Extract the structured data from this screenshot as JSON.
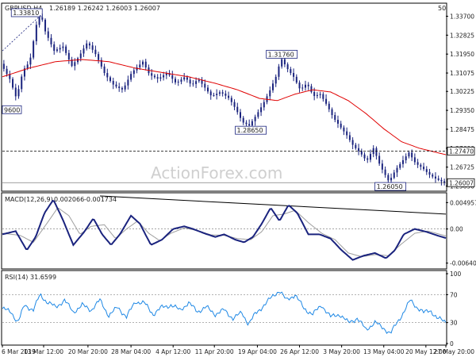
{
  "chart_data": [
    {
      "type": "candlestick",
      "header": {
        "symbol_tf": "GBPUSD,H4",
        "ohlc": "1.26189 1.26242 1.26003 1.26007",
        "corner_value": "50"
      },
      "y_ticks": [
        "1.33700",
        "1.32825",
        "1.31950",
        "1.31075",
        "1.30225",
        "1.29350",
        "1.28475",
        "1.27600",
        "1.26725",
        "1.25850"
      ],
      "ylim": [
        1.2565,
        1.339
      ],
      "sma_color": "#e00000",
      "candle_color": "#1a237e",
      "annotations": [
        {
          "text": "1.33810",
          "price": 1.3381,
          "t": 0.055
        },
        {
          "text": "1.31760",
          "price": 1.3176,
          "t": 0.63
        },
        {
          "text": "1.28650",
          "price": 1.2865,
          "t": 0.56
        },
        {
          "text": "1.26050",
          "price": 1.2605,
          "t": 0.875
        },
        {
          "text": "9600",
          "price": 1.296,
          "t": 0.0
        }
      ],
      "level_labels": [
        {
          "text": "1.27470",
          "price": 1.2747,
          "style": "dashed"
        },
        {
          "text": "1.26007",
          "price": 1.26007,
          "style": "current"
        }
      ],
      "close_path": [
        [
          0.0,
          1.315
        ],
        [
          0.02,
          1.308
        ],
        [
          0.035,
          1.299
        ],
        [
          0.05,
          1.312
        ],
        [
          0.065,
          1.316
        ],
        [
          0.08,
          1.333
        ],
        [
          0.09,
          1.3381
        ],
        [
          0.1,
          1.33
        ],
        [
          0.12,
          1.321
        ],
        [
          0.14,
          1.323
        ],
        [
          0.16,
          1.314
        ],
        [
          0.175,
          1.318
        ],
        [
          0.195,
          1.325
        ],
        [
          0.215,
          1.319
        ],
        [
          0.235,
          1.31
        ],
        [
          0.255,
          1.305
        ],
        [
          0.275,
          1.303
        ],
        [
          0.295,
          1.311
        ],
        [
          0.32,
          1.316
        ],
        [
          0.335,
          1.31
        ],
        [
          0.355,
          1.308
        ],
        [
          0.375,
          1.311
        ],
        [
          0.395,
          1.306
        ],
        [
          0.415,
          1.309
        ],
        [
          0.43,
          1.305
        ],
        [
          0.445,
          1.308
        ],
        [
          0.46,
          1.304
        ],
        [
          0.475,
          1.3
        ],
        [
          0.495,
          1.302
        ],
        [
          0.515,
          1.299
        ],
        [
          0.53,
          1.294
        ],
        [
          0.545,
          1.288
        ],
        [
          0.56,
          1.2865
        ],
        [
          0.575,
          1.291
        ],
        [
          0.59,
          1.296
        ],
        [
          0.605,
          1.302
        ],
        [
          0.62,
          1.309
        ],
        [
          0.632,
          1.3176
        ],
        [
          0.645,
          1.313
        ],
        [
          0.66,
          1.309
        ],
        [
          0.675,
          1.303
        ],
        [
          0.69,
          1.306
        ],
        [
          0.705,
          1.3
        ],
        [
          0.72,
          1.301
        ],
        [
          0.735,
          1.296
        ],
        [
          0.75,
          1.29
        ],
        [
          0.765,
          1.286
        ],
        [
          0.78,
          1.282
        ],
        [
          0.795,
          1.277
        ],
        [
          0.81,
          1.274
        ],
        [
          0.825,
          1.27
        ],
        [
          0.84,
          1.276
        ],
        [
          0.855,
          1.268
        ],
        [
          0.875,
          1.2605
        ],
        [
          0.89,
          1.266
        ],
        [
          0.905,
          1.27
        ],
        [
          0.92,
          1.274
        ],
        [
          0.935,
          1.269
        ],
        [
          0.95,
          1.267
        ],
        [
          0.965,
          1.264
        ],
        [
          0.98,
          1.262
        ],
        [
          1.0,
          1.26007
        ]
      ],
      "sma_path": [
        [
          0.0,
          1.309
        ],
        [
          0.06,
          1.313
        ],
        [
          0.12,
          1.316
        ],
        [
          0.18,
          1.317
        ],
        [
          0.24,
          1.316
        ],
        [
          0.3,
          1.313
        ],
        [
          0.36,
          1.311
        ],
        [
          0.42,
          1.309
        ],
        [
          0.48,
          1.306
        ],
        [
          0.53,
          1.303
        ],
        [
          0.58,
          1.299
        ],
        [
          0.62,
          1.298
        ],
        [
          0.66,
          1.301
        ],
        [
          0.7,
          1.303
        ],
        [
          0.74,
          1.302
        ],
        [
          0.78,
          1.298
        ],
        [
          0.82,
          1.292
        ],
        [
          0.86,
          1.285
        ],
        [
          0.9,
          1.279
        ],
        [
          0.94,
          1.276
        ],
        [
          1.0,
          1.273
        ]
      ]
    },
    {
      "type": "line",
      "title": "MACD(12,26,9) 0.002066 -0.001734",
      "title_parts": [
        "MACD(12,26,9)",
        "0.002066",
        "-0.001734"
      ],
      "y_ticks": [
        "0.004957",
        "0.00",
        "-0.006404"
      ],
      "ylim": [
        -0.0072,
        0.0062
      ],
      "series": [
        {
          "color": "#1a237e",
          "values": [
            [
              0.0,
              -0.001
            ],
            [
              0.03,
              -0.0004
            ],
            [
              0.055,
              -0.004
            ],
            [
              0.075,
              -0.0015
            ],
            [
              0.095,
              0.003
            ],
            [
              0.115,
              0.0055
            ],
            [
              0.135,
              0.002
            ],
            [
              0.16,
              -0.003
            ],
            [
              0.185,
              -0.0005
            ],
            [
              0.205,
              0.002
            ],
            [
              0.225,
              -0.001
            ],
            [
              0.245,
              -0.003
            ],
            [
              0.265,
              -0.001
            ],
            [
              0.29,
              0.0025
            ],
            [
              0.31,
              0.001
            ],
            [
              0.335,
              -0.003
            ],
            [
              0.36,
              -0.002
            ],
            [
              0.385,
              0.0
            ],
            [
              0.41,
              0.0005
            ],
            [
              0.43,
              0.0
            ],
            [
              0.455,
              -0.0008
            ],
            [
              0.48,
              -0.0015
            ],
            [
              0.5,
              -0.001
            ],
            [
              0.525,
              -0.002
            ],
            [
              0.545,
              -0.0025
            ],
            [
              0.565,
              -0.0015
            ],
            [
              0.585,
              0.001
            ],
            [
              0.605,
              0.004
            ],
            [
              0.625,
              0.0015
            ],
            [
              0.645,
              0.0045
            ],
            [
              0.665,
              0.003
            ],
            [
              0.69,
              -0.001
            ],
            [
              0.715,
              -0.001
            ],
            [
              0.74,
              -0.0018
            ],
            [
              0.765,
              -0.004
            ],
            [
              0.79,
              -0.0058
            ],
            [
              0.815,
              -0.005
            ],
            [
              0.84,
              -0.0045
            ],
            [
              0.865,
              -0.0055
            ],
            [
              0.885,
              -0.004
            ],
            [
              0.905,
              -0.001
            ],
            [
              0.93,
              0.0
            ],
            [
              0.955,
              -0.0005
            ],
            [
              0.98,
              -0.0012
            ],
            [
              1.0,
              -0.0017
            ]
          ]
        },
        {
          "color": "#9e9e9e",
          "values": [
            [
              0.0,
              -0.0008
            ],
            [
              0.04,
              -0.0012
            ],
            [
              0.07,
              -0.0025
            ],
            [
              0.1,
              0.001
            ],
            [
              0.125,
              0.004
            ],
            [
              0.15,
              0.0025
            ],
            [
              0.175,
              -0.001
            ],
            [
              0.2,
              0.0005
            ],
            [
              0.23,
              0.0008
            ],
            [
              0.255,
              -0.0018
            ],
            [
              0.28,
              0.0
            ],
            [
              0.305,
              0.0015
            ],
            [
              0.33,
              -0.0008
            ],
            [
              0.355,
              -0.0022
            ],
            [
              0.38,
              -0.0008
            ],
            [
              0.41,
              0.0002
            ],
            [
              0.44,
              -0.0003
            ],
            [
              0.47,
              -0.0011
            ],
            [
              0.5,
              -0.0012
            ],
            [
              0.53,
              -0.0018
            ],
            [
              0.56,
              -0.002
            ],
            [
              0.585,
              -0.0005
            ],
            [
              0.61,
              0.0025
            ],
            [
              0.635,
              0.0028
            ],
            [
              0.66,
              0.0035
            ],
            [
              0.69,
              0.0012
            ],
            [
              0.72,
              -0.0008
            ],
            [
              0.75,
              -0.002
            ],
            [
              0.78,
              -0.0045
            ],
            [
              0.81,
              -0.0052
            ],
            [
              0.84,
              -0.0048
            ],
            [
              0.87,
              -0.005
            ],
            [
              0.9,
              -0.0028
            ],
            [
              0.93,
              -0.0008
            ],
            [
              0.96,
              -0.0004
            ],
            [
              1.0,
              -0.0013
            ]
          ]
        }
      ],
      "trendline": [
        [
          0.22,
          0.0062
        ],
        [
          1.0,
          0.0028
        ]
      ],
      "zero_line": 0
    },
    {
      "type": "line",
      "title": "RSI(14) 31.6599",
      "title_parts": [
        "RSI(14)",
        "31.6599"
      ],
      "y_ticks": [
        "100",
        "70",
        "30",
        "0"
      ],
      "ylim": [
        0,
        100
      ],
      "levels": [
        70,
        30
      ],
      "series": [
        {
          "color": "#1e88e5",
          "values": [
            [
              0.0,
              50
            ],
            [
              0.02,
              45
            ],
            [
              0.035,
              30
            ],
            [
              0.05,
              55
            ],
            [
              0.07,
              48
            ],
            [
              0.085,
              70
            ],
            [
              0.1,
              60
            ],
            [
              0.12,
              52
            ],
            [
              0.14,
              62
            ],
            [
              0.16,
              45
            ],
            [
              0.18,
              55
            ],
            [
              0.2,
              48
            ],
            [
              0.22,
              62
            ],
            [
              0.24,
              40
            ],
            [
              0.26,
              52
            ],
            [
              0.28,
              38
            ],
            [
              0.3,
              60
            ],
            [
              0.32,
              58
            ],
            [
              0.34,
              42
            ],
            [
              0.36,
              52
            ],
            [
              0.38,
              55
            ],
            [
              0.4,
              48
            ],
            [
              0.42,
              58
            ],
            [
              0.44,
              46
            ],
            [
              0.46,
              52
            ],
            [
              0.48,
              42
            ],
            [
              0.5,
              48
            ],
            [
              0.52,
              36
            ],
            [
              0.54,
              44
            ],
            [
              0.555,
              28
            ],
            [
              0.57,
              42
            ],
            [
              0.59,
              55
            ],
            [
              0.61,
              68
            ],
            [
              0.625,
              76
            ],
            [
              0.64,
              62
            ],
            [
              0.66,
              70
            ],
            [
              0.68,
              50
            ],
            [
              0.7,
              42
            ],
            [
              0.72,
              55
            ],
            [
              0.74,
              38
            ],
            [
              0.76,
              42
            ],
            [
              0.78,
              30
            ],
            [
              0.8,
              36
            ],
            [
              0.82,
              20
            ],
            [
              0.84,
              30
            ],
            [
              0.86,
              22
            ],
            [
              0.875,
              14
            ],
            [
              0.89,
              30
            ],
            [
              0.905,
              45
            ],
            [
              0.92,
              62
            ],
            [
              0.935,
              52
            ],
            [
              0.95,
              44
            ],
            [
              0.965,
              48
            ],
            [
              0.98,
              36
            ],
            [
              1.0,
              31.66
            ]
          ]
        }
      ]
    }
  ],
  "x_axis": {
    "labels": [
      "6 Mar 2019",
      "13 Mar 12:00",
      "20 Mar 20:00",
      "28 Mar 04:00",
      "4 Apr 12:00",
      "11 Apr 20:00",
      "19 Apr 04:00",
      "26 Apr 12:00",
      "3 May 20:00",
      "13 May 04:00",
      "20 May 12:00",
      "27 May 20:00"
    ],
    "positions": [
      0.0,
      0.093,
      0.193,
      0.29,
      0.385,
      0.478,
      0.575,
      0.67,
      0.765,
      0.86,
      0.955,
      1.0
    ]
  },
  "watermark": "ActionForex.com"
}
